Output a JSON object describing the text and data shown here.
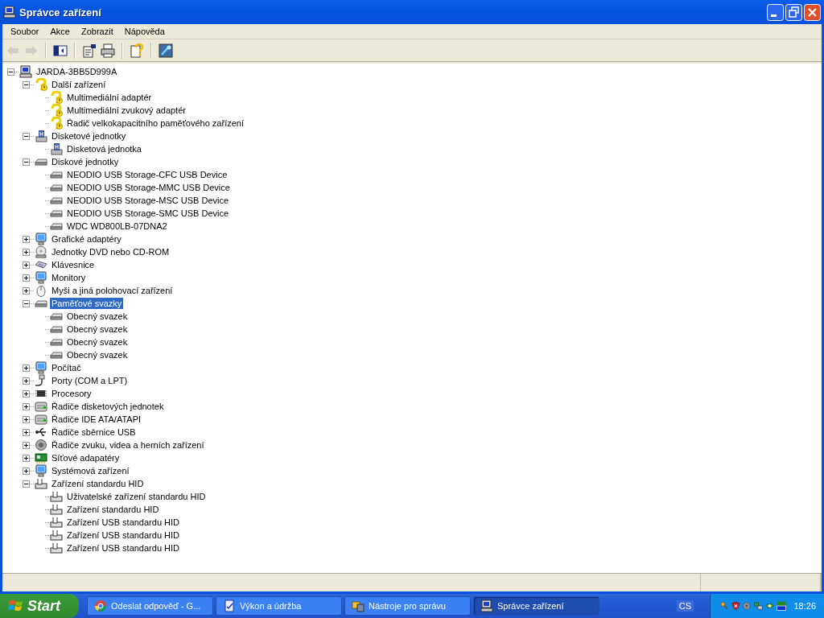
{
  "window": {
    "title": "Správce zařízení"
  },
  "menu": [
    {
      "label": "Soubor"
    },
    {
      "label": "Akce"
    },
    {
      "label": "Zobrazit"
    },
    {
      "label": "Nápověda"
    }
  ],
  "toolbar": [
    {
      "kind": "back",
      "disabled": true
    },
    {
      "kind": "forward",
      "disabled": true
    },
    {
      "kind": "separator"
    },
    {
      "kind": "tree",
      "disabled": false
    },
    {
      "kind": "separator"
    },
    {
      "kind": "properties",
      "disabled": false
    },
    {
      "kind": "print",
      "disabled": false
    },
    {
      "kind": "separator"
    },
    {
      "kind": "help",
      "disabled": false
    },
    {
      "kind": "separator"
    },
    {
      "kind": "scan",
      "disabled": false
    }
  ],
  "tree": [
    {
      "label": "JARDA-3BB5D999A",
      "kind": "computer",
      "expanded": true,
      "selected": false,
      "children": [
        {
          "label": "Další zařízení",
          "kind": "unknown",
          "expanded": true,
          "selected": false,
          "children": [
            {
              "label": "Multimediální adaptér",
              "kind": "unknown",
              "selected": false
            },
            {
              "label": "Multimediální zvukový adaptér",
              "kind": "unknown",
              "selected": false
            },
            {
              "label": "Řadič velkokapacitního paměťového zařízení",
              "kind": "unknown",
              "selected": false
            }
          ]
        },
        {
          "label": "Disketové jednotky",
          "kind": "floppy",
          "expanded": true,
          "selected": false,
          "children": [
            {
              "label": "Disketová jednotka",
              "kind": "floppy",
              "selected": false
            }
          ]
        },
        {
          "label": "Diskové jednotky",
          "kind": "disk",
          "expanded": true,
          "selected": false,
          "children": [
            {
              "label": "NEODIO USB Storage-CFC USB Device",
              "kind": "disk",
              "selected": false
            },
            {
              "label": "NEODIO USB Storage-MMC USB Device",
              "kind": "disk",
              "selected": false
            },
            {
              "label": "NEODIO USB Storage-MSC USB Device",
              "kind": "disk",
              "selected": false
            },
            {
              "label": "NEODIO USB Storage-SMC USB Device",
              "kind": "disk",
              "selected": false
            },
            {
              "label": "WDC WD800LB-07DNA2",
              "kind": "disk",
              "selected": false
            }
          ]
        },
        {
          "label": "Grafické adaptéry",
          "kind": "display",
          "expanded": false,
          "selected": false
        },
        {
          "label": "Jednotky DVD nebo CD-ROM",
          "kind": "cdrom",
          "expanded": false,
          "selected": false
        },
        {
          "label": "Klávesnice",
          "kind": "keyboard",
          "expanded": false,
          "selected": false
        },
        {
          "label": "Monitory",
          "kind": "display",
          "expanded": false,
          "selected": false
        },
        {
          "label": "Myši a jiná polohovací zařízení",
          "kind": "mouse",
          "expanded": false,
          "selected": false
        },
        {
          "label": "Paměťové svazky",
          "kind": "disk",
          "expanded": true,
          "selected": true,
          "children": [
            {
              "label": "Obecný svazek",
              "kind": "disk",
              "selected": false
            },
            {
              "label": "Obecný svazek",
              "kind": "disk",
              "selected": false
            },
            {
              "label": "Obecný svazek",
              "kind": "disk",
              "selected": false
            },
            {
              "label": "Obecný svazek",
              "kind": "disk",
              "selected": false
            }
          ]
        },
        {
          "label": "Počítač",
          "kind": "display",
          "expanded": false,
          "selected": false
        },
        {
          "label": "Porty (COM a LPT)",
          "kind": "port",
          "expanded": false,
          "selected": false
        },
        {
          "label": "Procesory",
          "kind": "cpu",
          "expanded": false,
          "selected": false
        },
        {
          "label": "Řadiče disketových jednotek",
          "kind": "controller",
          "expanded": false,
          "selected": false
        },
        {
          "label": "Řadiče IDE ATA/ATAPI",
          "kind": "controller",
          "expanded": false,
          "selected": false
        },
        {
          "label": "Řadiče sběrnice USB",
          "kind": "usb",
          "expanded": false,
          "selected": false
        },
        {
          "label": "Řadiče zvuku, videa a herních zařízení",
          "kind": "sound",
          "expanded": false,
          "selected": false
        },
        {
          "label": "Síťové adapatéry",
          "kind": "network",
          "expanded": false,
          "selected": false
        },
        {
          "label": "Systémová zařízení",
          "kind": "display",
          "expanded": false,
          "selected": false
        },
        {
          "label": "Zařízení standardu HID",
          "kind": "hid",
          "expanded": true,
          "selected": false,
          "children": [
            {
              "label": "Uživatelské zařízení standardu HID",
              "kind": "hid",
              "selected": false
            },
            {
              "label": "Zařízení standardu HID",
              "kind": "hid",
              "selected": false
            },
            {
              "label": "Zařízení USB standardu HID",
              "kind": "hid",
              "selected": false
            },
            {
              "label": "Zařízení USB standardu HID",
              "kind": "hid",
              "selected": false
            },
            {
              "label": "Zařízení USB standardu HID",
              "kind": "hid",
              "selected": false
            }
          ]
        }
      ]
    }
  ],
  "taskbar": {
    "start": "Start",
    "tasks": [
      {
        "label": "Odeslat odpověď - G...",
        "kind": "browser",
        "selected": false
      },
      {
        "label": "Výkon a údržba",
        "kind": "tasks",
        "selected": false
      },
      {
        "label": "Nástroje pro správu",
        "kind": "tools",
        "selected": false
      },
      {
        "label": "Správce zařízení",
        "kind": "computer",
        "selected": true
      }
    ],
    "language": "CS",
    "clock": "18:26"
  }
}
